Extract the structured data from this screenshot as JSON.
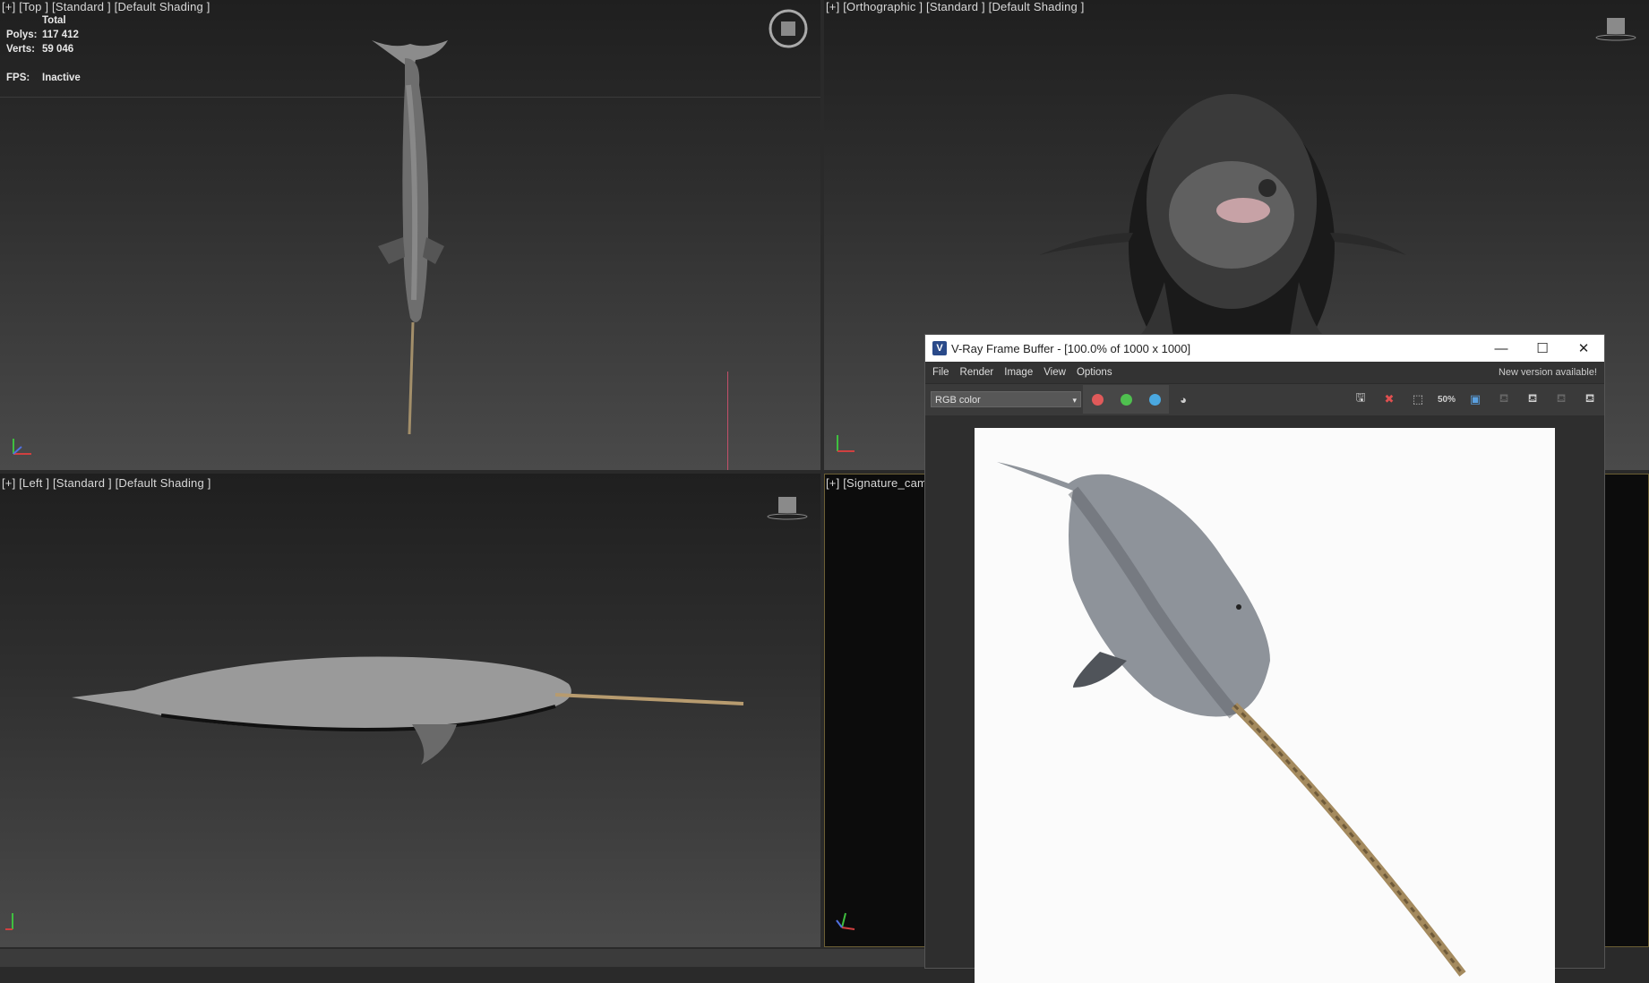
{
  "viewports": {
    "top": {
      "label": "[+] [Top ] [Standard ] [Default Shading ]"
    },
    "ortho": {
      "label": "[+] [Orthographic ] [Standard ] [Default Shading ]"
    },
    "left": {
      "label": "[+] [Left ] [Standard ] [Default Shading ]"
    },
    "camera": {
      "label": "[+] [Signature_cam ]"
    }
  },
  "stats": {
    "total_label": "Total",
    "polys_label": "Polys:",
    "polys_value": "117 412",
    "verts_label": "Verts:",
    "verts_value": "59 046",
    "fps_label": "FPS:",
    "fps_value": "Inactive"
  },
  "vfb": {
    "title": "V-Ray Frame Buffer - [100.0% of 1000 x 1000]",
    "menu": [
      "File",
      "Render",
      "Image",
      "View",
      "Options"
    ],
    "new_version": "New version available!",
    "channel": "RGB color",
    "zoom_label": "50%",
    "channel_colors": {
      "red": "#e05a5a",
      "green": "#4fc04f",
      "blue": "#4aa8e0"
    }
  },
  "icons": {
    "gizmo_top": "viewcube-compass-icon",
    "gizmo_ortho": "viewcube-icon",
    "gizmo_left": "viewcube-icon"
  }
}
